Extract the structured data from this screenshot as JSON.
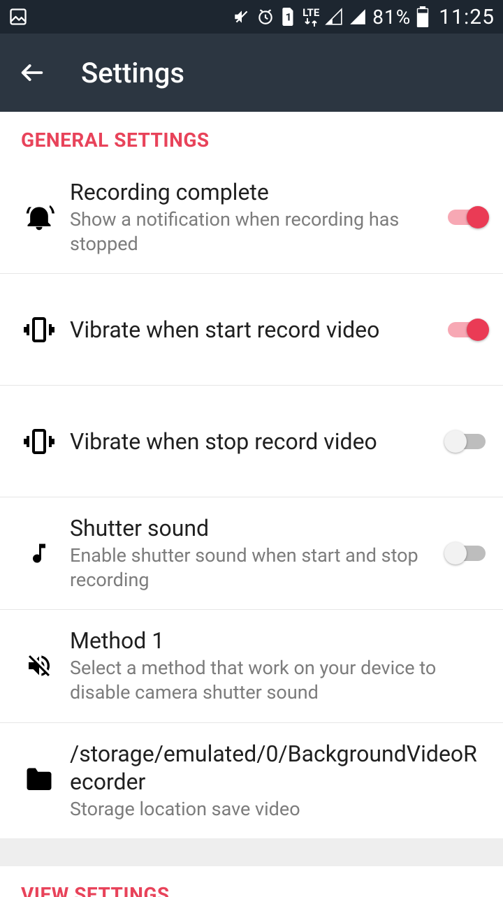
{
  "status": {
    "battery": "81%",
    "time": "11:25",
    "lte": "LTE"
  },
  "appbar": {
    "title": "Settings"
  },
  "sections": {
    "general": "GENERAL SETTINGS",
    "view": "VIEW SETTINGS"
  },
  "rows": {
    "recording_complete": {
      "title": "Recording complete",
      "sub": "Show a notification when recording has stopped",
      "on": true
    },
    "vibrate_start": {
      "title": "Vibrate when start record video",
      "on": true
    },
    "vibrate_stop": {
      "title": "Vibrate when stop record video",
      "on": false
    },
    "shutter": {
      "title": "Shutter sound",
      "sub": "Enable shutter sound when start and stop recording",
      "on": false
    },
    "method": {
      "title": "Method 1",
      "sub": "Select a method that work on your device to disable camera shutter sound"
    },
    "storage": {
      "title": "/storage/emulated/0/BackgroundVideoRecorder",
      "sub": "Storage location save video"
    }
  }
}
